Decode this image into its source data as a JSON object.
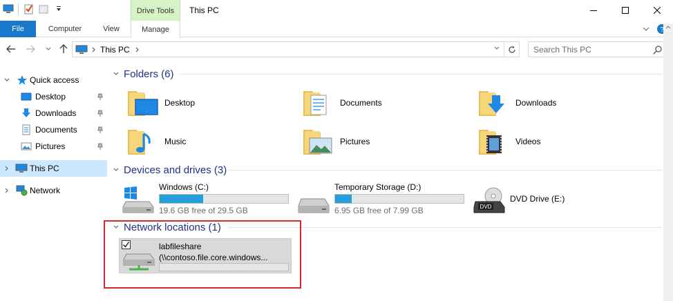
{
  "window": {
    "title": "This PC",
    "context_tab_group": "Drive Tools"
  },
  "ribbon": {
    "tabs": [
      {
        "label": "File",
        "active": true
      },
      {
        "label": "Computer"
      },
      {
        "label": "View"
      },
      {
        "label": "Manage"
      }
    ]
  },
  "address": {
    "path": "This PC",
    "search_placeholder": "Search This PC"
  },
  "sidebar": {
    "items": [
      {
        "label": "Quick access",
        "icon": "star-icon"
      },
      {
        "label": "Desktop",
        "icon": "desktop-folder-icon",
        "pinned": true
      },
      {
        "label": "Downloads",
        "icon": "downloads-folder-icon",
        "pinned": true
      },
      {
        "label": "Documents",
        "icon": "documents-folder-icon",
        "pinned": true
      },
      {
        "label": "Pictures",
        "icon": "pictures-folder-icon",
        "pinned": true
      },
      {
        "label": "This PC",
        "icon": "computer-icon",
        "selected": true
      },
      {
        "label": "Network",
        "icon": "network-icon"
      }
    ]
  },
  "groups": {
    "folders": {
      "header": "Folders (6)",
      "items": [
        {
          "label": "Desktop",
          "icon": "desktop-folder-icon"
        },
        {
          "label": "Documents",
          "icon": "documents-folder-icon"
        },
        {
          "label": "Downloads",
          "icon": "downloads-folder-icon"
        },
        {
          "label": "Music",
          "icon": "music-folder-icon"
        },
        {
          "label": "Pictures",
          "icon": "pictures-folder-icon"
        },
        {
          "label": "Videos",
          "icon": "videos-folder-icon"
        }
      ]
    },
    "devices": {
      "header": "Devices and drives (3)",
      "items": [
        {
          "label": "Windows (C:)",
          "free": "19.6 GB free of 29.5 GB",
          "used_fraction": 0.34,
          "icon": "windows-drive-icon"
        },
        {
          "label": "Temporary Storage (D:)",
          "free": "6.95 GB free of 7.99 GB",
          "used_fraction": 0.13,
          "icon": "hard-drive-icon"
        },
        {
          "label": "DVD Drive (E:)",
          "icon": "dvd-drive-icon",
          "badge": "DVD"
        }
      ]
    },
    "network": {
      "header": "Network locations (1)",
      "items": [
        {
          "label": "labfileshare",
          "path": "(\\\\contoso.file.core.windows...",
          "used_fraction": 0.0,
          "selected": true,
          "icon": "network-drive-icon"
        }
      ]
    }
  },
  "colors": {
    "accent": "#1979ca",
    "header_text": "#1e3287",
    "bar_fill": "#26a0da",
    "selection": "#cce8ff",
    "highlight": "#d62a2a",
    "context_tab": "#d6f3c6"
  }
}
